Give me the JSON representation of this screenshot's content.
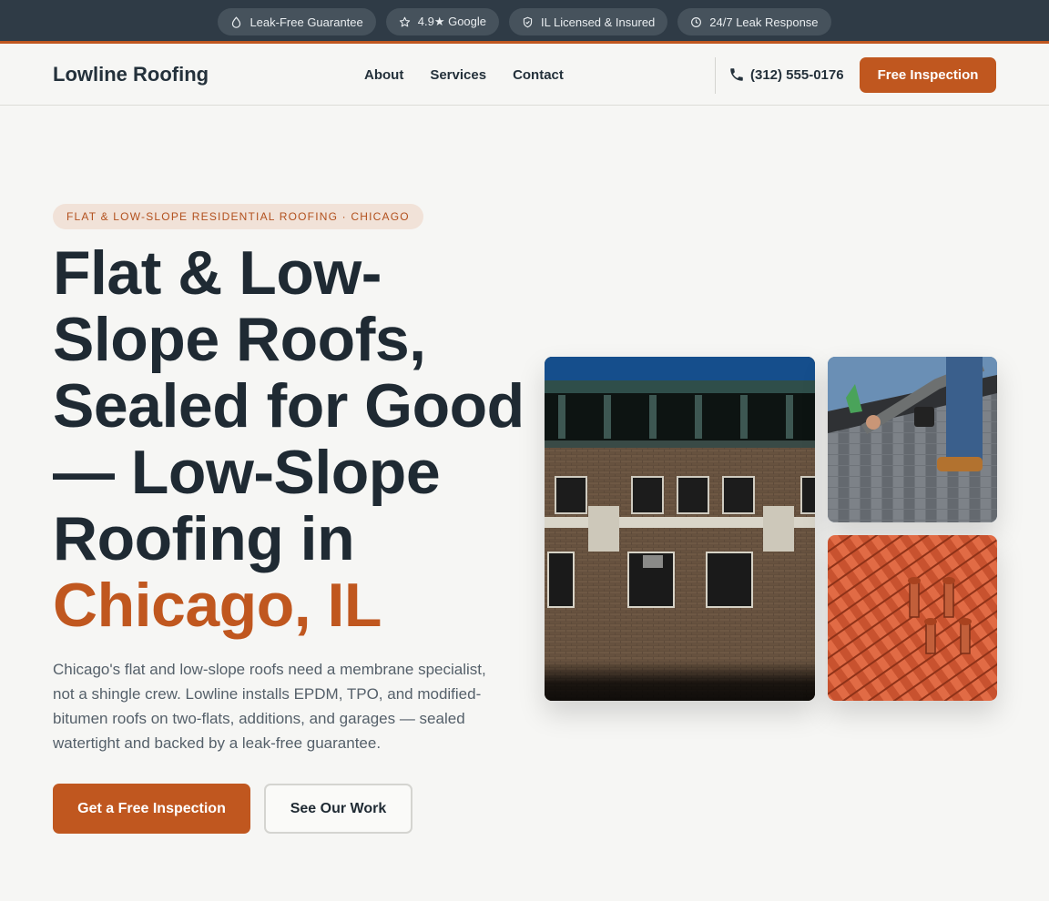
{
  "topbar": {
    "badges": [
      {
        "label": "Leak-Free Guarantee",
        "icon": "droplet-icon"
      },
      {
        "label": "4.9★ Google",
        "icon": "star-icon"
      },
      {
        "label": "IL Licensed & Insured",
        "icon": "shield-check-icon"
      },
      {
        "label": "24/7 Leak Response",
        "icon": "clock-icon"
      }
    ]
  },
  "nav": {
    "logo": "Lowline Roofing",
    "links": [
      "About",
      "Services",
      "Contact"
    ],
    "phone": "(312) 555-0176",
    "cta": "Free Inspection"
  },
  "hero": {
    "eyebrow": "FLAT & LOW-SLOPE RESIDENTIAL ROOFING · CHICAGO",
    "headline_main": "Flat & Low-Slope Roofs, Sealed for Good — Low-Slope Roofing in ",
    "headline_accent": "Chicago, IL",
    "lede": "Chicago's flat and low-slope roofs need a membrane specialist, not a shingle crew. Lowline installs EPDM, TPO, and modified-bitumen roofs on two-flats, additions, and garages — sealed watertight and backed by a leak-free guarantee.",
    "primary_cta": "Get a Free Inspection",
    "secondary_cta": "See Our Work"
  },
  "colors": {
    "accent": "#c0571f",
    "topbar": "#2f3b46",
    "text": "#1f2a33",
    "muted": "#55606a"
  }
}
